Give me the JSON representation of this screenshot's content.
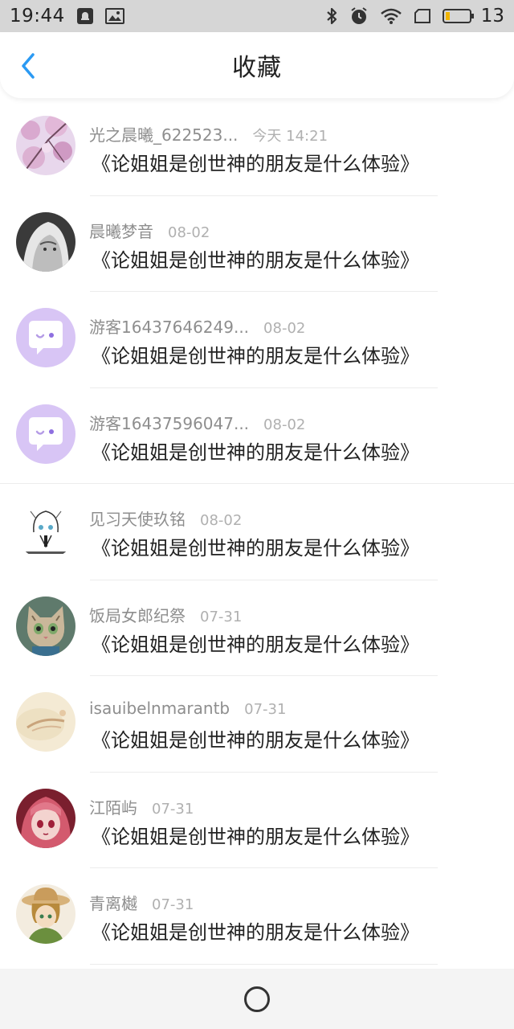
{
  "status_bar": {
    "time": "19:44",
    "battery": "13",
    "icons": [
      "notification-icon",
      "image-icon",
      "bluetooth-icon",
      "alarm-icon",
      "wifi-icon",
      "sim-icon",
      "battery-icon"
    ]
  },
  "header": {
    "title": "收藏",
    "back_icon": "back-chevron-icon"
  },
  "colors": {
    "accent": "#2b9af3",
    "name_gray": "#8e8e8e",
    "time_gray": "#b0b0b0",
    "default_avatar": "#d7c3f4"
  },
  "items": [
    {
      "name": "光之晨曦_622523...",
      "time": "今天 14:21",
      "title": "《论姐姐是创世神的朋友是什么体验》",
      "avatar": "sakura-avatar"
    },
    {
      "name": "晨曦梦音",
      "time": "08-02",
      "title": "《论姐姐是创世神的朋友是什么体验》",
      "avatar": "anime-gray-avatar"
    },
    {
      "name": "游客16437646249...",
      "time": "08-02",
      "title": "《论姐姐是创世神的朋友是什么体验》",
      "avatar": "default-chat-avatar"
    },
    {
      "name": "游客16437596047...",
      "time": "08-02",
      "title": "《论姐姐是创世神的朋友是什么体验》",
      "avatar": "default-chat-avatar"
    },
    {
      "name": "见习天使玖铭",
      "time": "08-02",
      "title": "《论姐姐是创世神的朋友是什么体验》",
      "avatar": "sketch-character-avatar"
    },
    {
      "name": "饭局女郎纪祭",
      "time": "07-31",
      "title": "《论姐姐是创世神的朋友是什么体验》",
      "avatar": "cat-avatar"
    },
    {
      "name": "isauibelnmarantb",
      "time": "07-31",
      "title": "《论姐姐是创世神的朋友是什么体验》",
      "avatar": "beige-landscape-avatar"
    },
    {
      "name": "江陌屿",
      "time": "07-31",
      "title": "《论姐姐是创世神的朋友是什么体验》",
      "avatar": "pink-hair-anime-avatar"
    },
    {
      "name": "青离樾",
      "time": "07-31",
      "title": "《论姐姐是创世神的朋友是什么体验》",
      "avatar": "straw-hat-anime-avatar"
    }
  ],
  "bottom_nav": {
    "home_icon": "home-circle-icon"
  }
}
